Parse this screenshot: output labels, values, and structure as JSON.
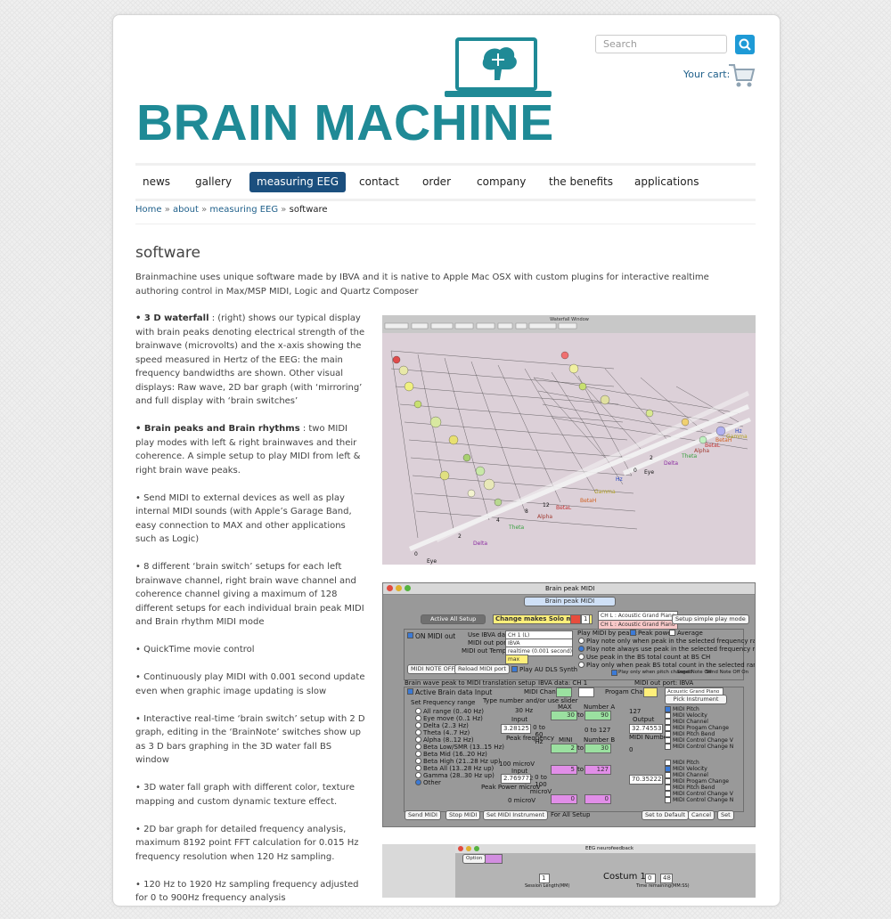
{
  "brand": {
    "name": "BRAIN MACHINE",
    "color": "#1f8a96"
  },
  "search": {
    "placeholder": "Search"
  },
  "cart": {
    "label": "Your cart:"
  },
  "nav": {
    "items": [
      {
        "label": "news"
      },
      {
        "label": "gallery"
      },
      {
        "label": "measuring EEG",
        "active": true
      },
      {
        "label": "contact"
      },
      {
        "label": "order"
      },
      {
        "label": "company"
      },
      {
        "label": "the benefits"
      },
      {
        "label": "applications"
      }
    ]
  },
  "breadcrumb": {
    "home": "Home",
    "about": "about",
    "measuring": "measuring EEG",
    "current": "software",
    "separator": "»"
  },
  "page": {
    "title": "software",
    "intro": "Brainmachine uses unique software made by IBVA and it is native to Apple Mac OSX with custom plugins for interactive realtime authoring control in Max/MSP MIDI, Logic and Quartz Composer"
  },
  "features": [
    {
      "bold": "• 3 D waterfall",
      "text": " : (right) shows our typical display with brain peaks denoting electrical strength of the brainwave (microvolts) and the x-axis showing the speed measured in Hertz of the EEG: the main frequency bandwidths are shown. Other visual displays: Raw wave, 2D bar graph (with ‘mirroring’ and full display with ‘brain switches’"
    },
    {
      "bold": "• Brain peaks and Brain rhythms",
      "text": " : two MIDI play modes with left & right brainwaves and their coherence. A simple setup to play MIDI from left & right brain wave peaks."
    },
    {
      "bold": "",
      "text": "• Send MIDI to external devices as well as play internal MIDI sounds (with Apple’s Garage Band, easy connection to MAX and other applications such as Logic)"
    },
    {
      "bold": "",
      "text": "• 8 different ‘brain switch’ setups for each left brainwave channel, right brain wave channel and coherence channel giving a maximum of 128 different setups for each individual brain peak MIDI and Brain rhythm MIDI mode"
    },
    {
      "bold": "",
      "text": "• QuickTime movie control"
    },
    {
      "bold": "",
      "text": "• Continuously play MIDI with 0.001 second update even when graphic image updating is slow"
    },
    {
      "bold": "",
      "text": "• Interactive real-time ‘brain switch’ setup with 2 D graph, editing in the ‘BrainNote’  switches show up as 3 D bars graphing in the 3D water fall BS window"
    },
    {
      "bold": "",
      "text": "• 3D water fall graph with different color, texture mapping and custom dynamic texture effect."
    },
    {
      "bold": "",
      "text": "• 2D bar graph for detailed frequency analysis, maximum 8192 point FFT calculation for 0.015 Hz frequency resolution when 120 Hz sampling."
    },
    {
      "bold": "",
      "text": "• 120 Hz to 1920 Hz sampling frequency adjusted for 0 to 900Hz frequency analysis"
    }
  ],
  "waterfall": {
    "window_title": "Waterfall Window",
    "left_bands": [
      "0",
      "Eye",
      "2",
      "Delta",
      "4",
      "Theta",
      "8",
      "Alpha",
      "12",
      "BetaL",
      "BetaH",
      "Gamma",
      "Hz"
    ],
    "right_bands": [
      "0",
      "Eye",
      "2",
      "Delta",
      "Theta",
      "Alpha",
      "BetaL",
      "BetaH",
      "Gamma",
      "Hz"
    ]
  },
  "peak_window": {
    "title": "Brain peak MIDI",
    "nav_label": "Brain peak MIDI",
    "active_all_setup": "Active All Setup",
    "solo_mode": "Change makes Solo mode :",
    "solo_value": "1",
    "piano1": "CH L : Acoustic Grand Piano",
    "piano2": "CH L : Acoustic Grand Piano",
    "simple_setup": "Setup simple play mode",
    "on_midi_out": "ON MIDI out",
    "use_ibva": "Use IBVA data",
    "use_ibva_val": "CH 1 (L)",
    "midi_port": "MIDI out port",
    "midi_port_val": "IBVA",
    "midi_tempo": "MIDI out Tempo",
    "midi_tempo_val": "realtime (0.001 second)",
    "max_label": "max",
    "play_by_peak": "Play MIDI by peak :",
    "peak_power": "Peak power",
    "average": "Average",
    "opt1": "Play note only when peak in the selected frequency range",
    "opt2": "Play note always use peak in the selected frequency range",
    "opt3": "Use peak in the BS total count at BS CH",
    "opt4": "Play only when peak BS total count in the selected range",
    "midi_note_off": "MIDI NOTE OFF",
    "reload_midi": "Reload MIDI port",
    "play_au": "Play AU DLS Synth",
    "play_changed": "Play only when pitch changed",
    "send_note_off": "Send Note Off",
    "send_note_off_on": "Send Note Off On",
    "translation": "Brain wave peak to MIDI translation setup",
    "ibva_data": "IBVA data: CH 1",
    "midi_port_ibva": "MIDI out port: IBVA",
    "active_input": "Active Brain data Input",
    "midi_channel": "MIDI Channel",
    "progam_change": "Progam Change",
    "instrument": "Acoustic Grand Piano",
    "pick_instrument": "Pick Instrument",
    "set_freq": "Set Frequency range",
    "type_number": "Type number and/or use slider",
    "ranges": [
      "All range (0..40 Hz)",
      "Eye move (0..1 Hz)",
      "Delta (2..3 Hz)",
      "Theta (4..7 Hz)",
      "Alpha (8..12 Hz)",
      "Beta Low/SMR (13..15 Hz)",
      "Beta Mid (16..20 Hz)",
      "Beta High (21..28 Hz up)",
      "Beta All (13..28 Hz up)",
      "Gamma (28..30 Hz up)",
      "Other"
    ],
    "hz30": "30 Hz",
    "input": "Input",
    "input_val": "3.28125",
    "hz_range": "0 to 60 Hz",
    "peak_freq": "Peak frequency",
    "max1": "MAX",
    "number_a": "Number A",
    "max1_val": "30",
    "to": "to",
    "numa_val": "90",
    "min1": "MINI",
    "number_b": "Number B",
    "min1_val": "2",
    "numb_val": "30",
    "zero_127": "0 to 127",
    "v127": "127",
    "output": "Output",
    "output_val": "32.74553",
    "midi_number": "MIDI Number",
    "v0": "0",
    "microv": "100 microV",
    "input2": "Input",
    "input2_val": "2.769772",
    "microv_range": "0 to 100 microV",
    "peak_power2": "Peak Power microV",
    "max2_val": "5",
    "numa2_val": "127",
    "min2_val": "0",
    "numb2_val": "0",
    "zero_microv": "0 microV",
    "output2_val": "70.35222",
    "pitch_list": [
      "MIDI Pitch",
      "MIDI Velocity",
      "MIDI Channel",
      "MIDI Progam Change",
      "MIDI Pitch Bend",
      "MIDI Control Change V",
      "MIDI Control Change N"
    ],
    "send_midi": "Send MIDI",
    "stop_midi": "Stop MIDI",
    "set_instrument": "Set MIDI Instrument",
    "for_all": "For All Setup",
    "set_default": "Set to Default",
    "cancel": "Cancel",
    "set": "Set"
  },
  "neuro_window": {
    "title": "EEG neurofeedback",
    "option": "Option",
    "costum": "Costum 1",
    "session": "Session Length(MM)",
    "remaining": "Time remaining(MM:SS)",
    "val1": "1",
    "val2": "0",
    "val3": "48"
  },
  "colors": {
    "accent": "#1b4f7e",
    "link": "#1e5f8a",
    "search_button": "#1e9ad6"
  }
}
